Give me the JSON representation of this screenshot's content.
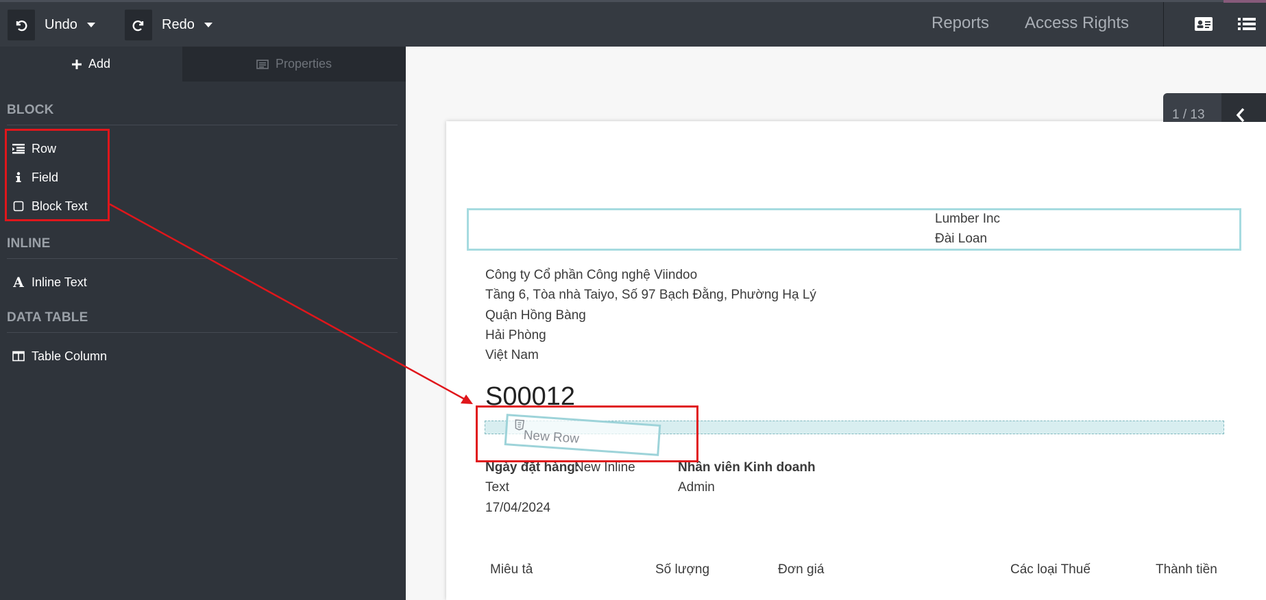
{
  "toolbar": {
    "undo_label": "Undo",
    "redo_label": "Redo",
    "reports_label": "Reports",
    "access_rights_label": "Access Rights"
  },
  "sidebar": {
    "tabs": [
      {
        "label": "Add",
        "active": true
      },
      {
        "label": "Properties",
        "active": false
      }
    ],
    "sections": [
      {
        "title": "BLOCK",
        "items": [
          {
            "label": "Row",
            "icon": "row-icon"
          },
          {
            "label": "Field",
            "icon": "info-icon"
          },
          {
            "label": "Block Text",
            "icon": "square-icon"
          }
        ]
      },
      {
        "title": "INLINE",
        "items": [
          {
            "label": "Inline Text",
            "icon": "text-a-icon"
          }
        ]
      },
      {
        "title": "DATA TABLE",
        "items": [
          {
            "label": "Table Column",
            "icon": "columns-icon"
          }
        ]
      }
    ]
  },
  "pager": {
    "text": "1 / 13"
  },
  "document": {
    "customer": [
      "Lumber Inc",
      "Đài Loan"
    ],
    "company": [
      "Công ty Cổ phần Công nghệ Viindoo",
      "Tầng 6, Tòa nhà Taiyo, Số 97 Bạch Đằng, Phường Hạ Lý",
      "Quận Hồng Bàng",
      "Hải Phòng",
      "Việt Nam"
    ],
    "title": "S00012",
    "ghost_label": "New Row",
    "order_date_label": "Ngày đặt hàng:",
    "order_date_inline": "New Inline",
    "order_date_inline_2": "Text",
    "order_date_value": "17/04/2024",
    "salesperson_label": "Nhân viên Kinh doanh",
    "salesperson_value": "Admin",
    "table_headers": [
      "Miêu tả",
      "Số lượng",
      "Đơn giá",
      "Các loại Thuế",
      "Thành tiền"
    ]
  },
  "colors": {
    "topbar": "#353a41",
    "sidebar": "#2f343b",
    "annotation_red": "#e0161b",
    "dropzone": "#d8eef0",
    "header_box_border": "#a6dbe0"
  }
}
